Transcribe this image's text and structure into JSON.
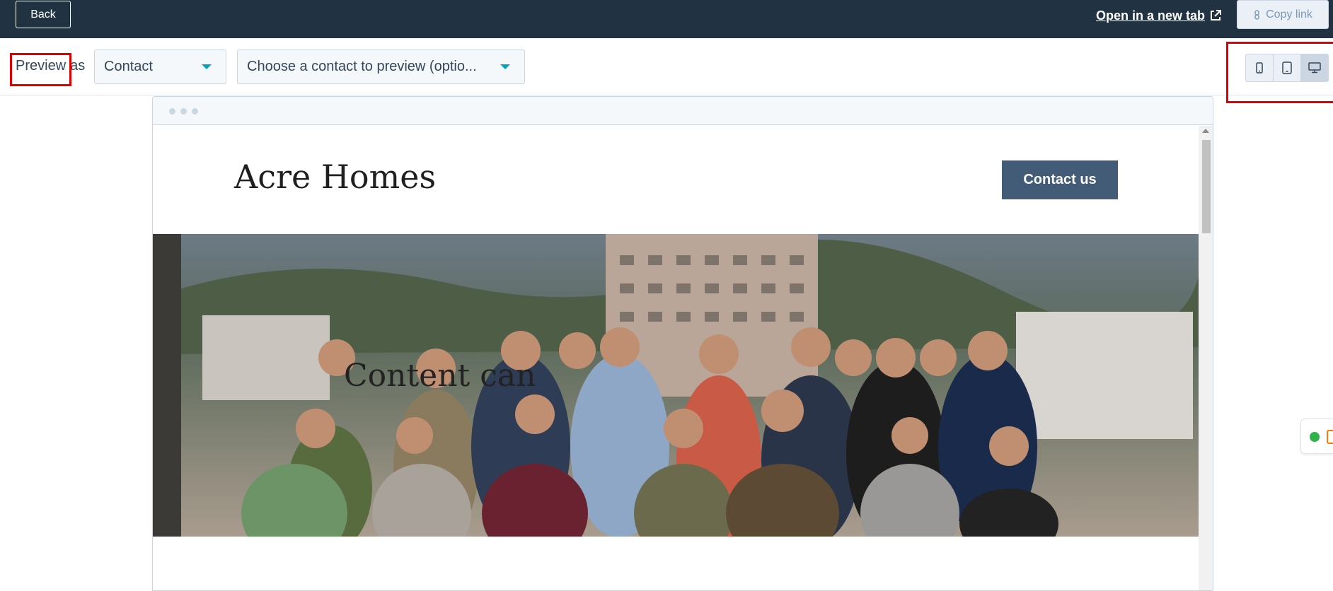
{
  "topbar": {
    "back_label": "Back",
    "open_tab_label": "Open in a new tab",
    "copy_link_label": "Copy link"
  },
  "preview": {
    "label_preview": "Preview",
    "label_as": "as",
    "contact_select_value": "Contact",
    "choose_contact_value": "Choose a contact to preview (optio..."
  },
  "devices": {
    "buttons": [
      "mobile-icon",
      "tablet-icon",
      "desktop-icon"
    ],
    "active": "desktop"
  },
  "site": {
    "title": "Acre Homes",
    "contact_button": "Contact us",
    "hero_text": "Content can"
  },
  "colors": {
    "topbar": "#213343",
    "contact_button": "#425b76",
    "caret": "#00a4bd",
    "highlight": "#e00000"
  }
}
